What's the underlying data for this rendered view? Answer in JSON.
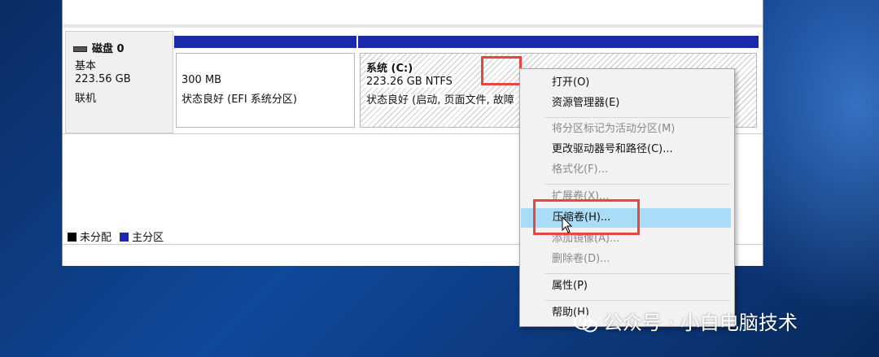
{
  "disk": {
    "name": "磁盘 0",
    "type": "基本",
    "size": "223.56 GB",
    "status": "联机"
  },
  "partitions": [
    {
      "size": "300 MB",
      "status": "状态良好 (EFI 系统分区)"
    },
    {
      "name": "系统 (C:)",
      "size": "223.26 GB NTFS",
      "status": "状态良好 (启动, 页面文件, 故障"
    }
  ],
  "legend": {
    "unallocated": "未分配",
    "primary": "主分区"
  },
  "context_menu": {
    "items": [
      {
        "label": "打开(O)",
        "enabled": true
      },
      {
        "label": "资源管理器(E)",
        "enabled": true
      },
      {
        "label": "将分区标记为活动分区(M)",
        "enabled": false
      },
      {
        "label": "更改驱动器号和路径(C)...",
        "enabled": true
      },
      {
        "label": "格式化(F)...",
        "enabled": false
      },
      {
        "label": "扩展卷(X)...",
        "enabled": false
      },
      {
        "label": "压缩卷(H)...",
        "enabled": true,
        "highlighted": true
      },
      {
        "label": "添加镜像(A)...",
        "enabled": false
      },
      {
        "label": "删除卷(D)...",
        "enabled": false
      },
      {
        "label": "属性(P)",
        "enabled": true
      },
      {
        "label": "帮助(H)",
        "enabled": true
      }
    ]
  },
  "watermark": "公众号 · 小白电脑技术",
  "colors": {
    "primary_partition": "#1a2aa8",
    "annotation": "#e8473f",
    "menu_hover": "#a9dcf7"
  }
}
